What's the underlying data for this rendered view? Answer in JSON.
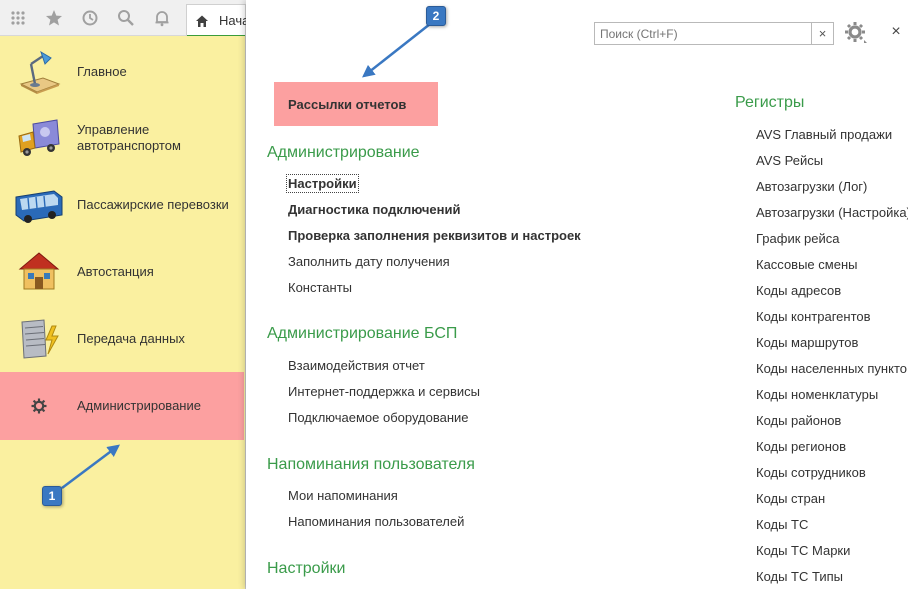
{
  "toolbar": {
    "icons": [
      "apps-grid-icon",
      "star-icon",
      "history-icon",
      "search-icon",
      "bell-icon"
    ],
    "home_tab_label": "Нача"
  },
  "sidebar": {
    "items": [
      {
        "label": "Главное",
        "icon": "desk-lamp-icon"
      },
      {
        "label": "Управление автотранспортом",
        "icon": "truck-icon"
      },
      {
        "label": "Пассажирские перевозки",
        "icon": "bus-icon"
      },
      {
        "label": "Автостанция",
        "icon": "station-icon"
      },
      {
        "label": "Передача данных",
        "icon": "server-icon"
      },
      {
        "label": "Администрирование",
        "icon": "gear-icon"
      }
    ]
  },
  "main": {
    "search_placeholder": "Поиск (Ctrl+F)",
    "clear_label": "×",
    "close_label": "×",
    "highlighted_report": "Рассылки отчетов",
    "sections": [
      {
        "title": "Администрирование",
        "items": [
          {
            "label": "Настройки",
            "bold": true
          },
          {
            "label": "Диагностика подключений",
            "bold": true
          },
          {
            "label": "Проверка заполнения реквизитов и настроек",
            "bold": true
          },
          {
            "label": "Заполнить дату получения",
            "bold": false
          },
          {
            "label": "Константы",
            "bold": false
          }
        ]
      },
      {
        "title": "Администрирование БСП",
        "items": [
          {
            "label": "Взаимодействия отчет",
            "bold": false
          },
          {
            "label": "Интернет-поддержка и сервисы",
            "bold": false
          },
          {
            "label": "Подключаемое оборудование",
            "bold": false
          }
        ]
      },
      {
        "title": "Напоминания пользователя",
        "items": [
          {
            "label": "Мои напоминания",
            "bold": false
          },
          {
            "label": "Напоминания пользователей",
            "bold": false
          }
        ]
      },
      {
        "title": "Настройки",
        "items": []
      }
    ],
    "registers": {
      "title": "Регистры",
      "items": [
        "AVS Главный продажи",
        "AVS Рейсы",
        "Автозагрузки (Лог)",
        "Автозагрузки (Настройка)",
        "График рейса",
        "Кассовые смены",
        "Коды адресов",
        "Коды контрагентов",
        "Коды маршрутов",
        "Коды населенных пункто",
        "Коды номенклатуры",
        "Коды районов",
        "Коды регионов",
        "Коды сотрудников",
        "Коды стран",
        "Коды ТС",
        "Коды ТС Марки",
        "Коды ТС Типы"
      ]
    }
  },
  "callouts": [
    {
      "number": "1"
    },
    {
      "number": "2"
    }
  ],
  "colors": {
    "sidebar_bg": "#faf0a0",
    "highlight": "#fca0a0",
    "section_green": "#3a9b4a",
    "callout_blue": "#3a78c2"
  }
}
